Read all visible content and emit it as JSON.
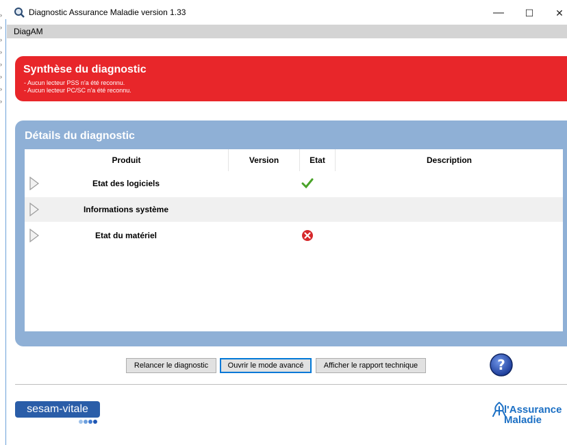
{
  "window": {
    "title": "Diagnostic Assurance Maladie version 1.33",
    "minimize": "—",
    "maximize": "☐",
    "close": "✕"
  },
  "menu": {
    "app_label": "DiagAM"
  },
  "summary": {
    "title": "Synthèse du diagnostic",
    "lines": [
      "- Aucun lecteur PSS n'a été reconnu.",
      "- Aucun lecteur PC/SC n'a été reconnu."
    ]
  },
  "details": {
    "title": "Détails du diagnostic",
    "columns": [
      "Produit",
      "Version",
      "Etat",
      "Description"
    ],
    "rows": [
      {
        "product": "Etat des logiciels",
        "status": "ok"
      },
      {
        "product": "Informations système",
        "status": "none"
      },
      {
        "product": "Etat du matériel",
        "status": "error"
      }
    ]
  },
  "buttons": {
    "rerun": "Relancer le diagnostic",
    "advanced": "Ouvrir le mode avancé",
    "report": "Afficher le rapport technique"
  },
  "footer": {
    "sesam_logo": "sesam-vitale",
    "am_logo_line1": "l'Assurance",
    "am_logo_line2": "Maladie"
  },
  "colors": {
    "alert": "#e8262a",
    "panel": "#8fb0d6",
    "brand": "#1b6fc4"
  }
}
